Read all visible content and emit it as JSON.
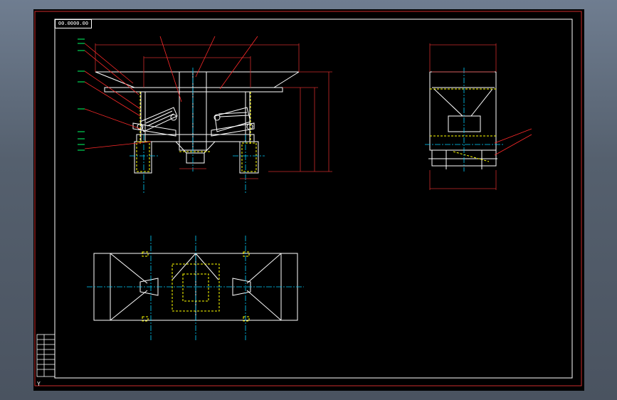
{
  "drawing": {
    "title_tag": "00.0000.00",
    "ucs_symbol": "Y"
  },
  "colors": {
    "frame_outer": "#cc2b2b",
    "frame_inner": "#ffffff",
    "geometry": "#ffffff",
    "dimension": "#cc2b2b",
    "leader": "#ff2a2a",
    "hidden": "#ffff00",
    "centerline": "#00d0ff",
    "callout": "#00ff66",
    "annotation": "#ffff00"
  },
  "icons": {
    "ucs": "ucs-axis-icon"
  }
}
